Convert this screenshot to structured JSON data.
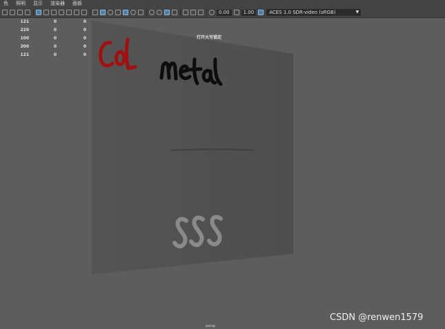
{
  "menu": {
    "items": [
      {
        "label": "色"
      },
      {
        "label": "照明"
      },
      {
        "label": "显示"
      },
      {
        "label": "渲染器"
      },
      {
        "label": "面板"
      }
    ]
  },
  "toolbar": {
    "exposure_value": "0.00",
    "gamma_value": "1.00",
    "color_space": "ACES 1.0 SDR-video (sRGB)"
  },
  "stats": {
    "rows": [
      [
        "121",
        "0",
        "0"
      ],
      [
        "220",
        "0",
        "0"
      ],
      [
        "100",
        "0",
        "0"
      ],
      [
        "200",
        "0",
        "0"
      ],
      [
        "121",
        "0",
        "0"
      ]
    ]
  },
  "viewport": {
    "hud_message": "打开大写锁定",
    "camera_label": "persp",
    "colors": {
      "background": "#5d5d5d",
      "plane": "#515151",
      "red_ink": "#a01010",
      "black_ink": "#0d0d0d",
      "gray_ink": "#8a8a8a"
    },
    "handwriting": {
      "red_word": "CoL",
      "black_word": "metal",
      "gray_word": "SSS"
    }
  },
  "watermark": "CSDN @renwen1579"
}
